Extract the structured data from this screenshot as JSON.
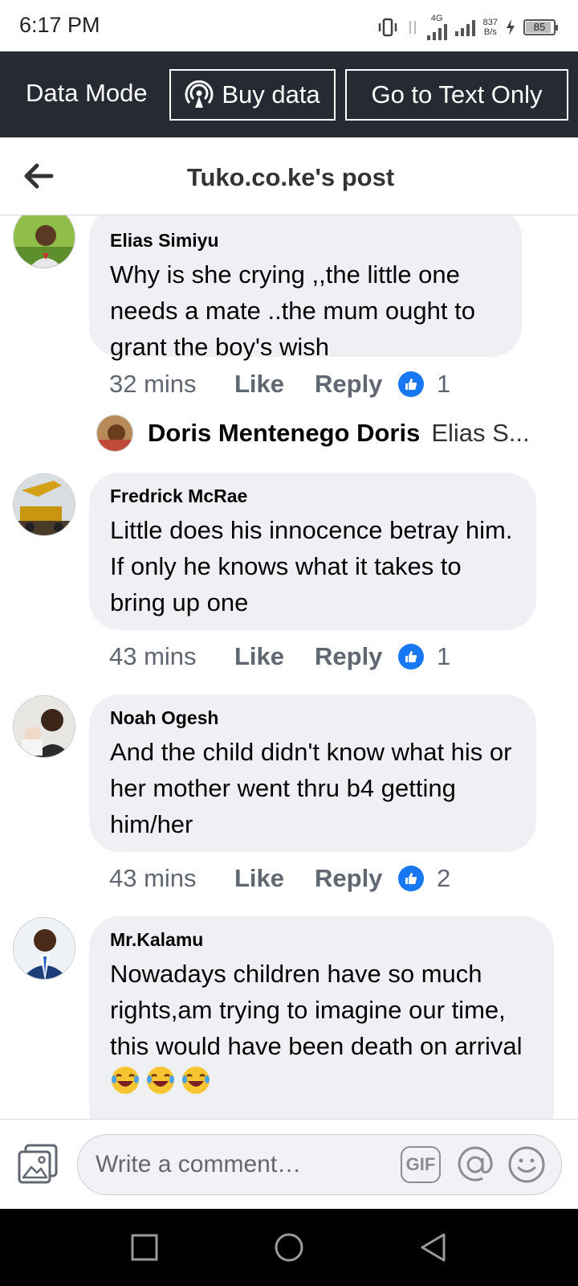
{
  "status_bar": {
    "time": "6:17 PM",
    "network_type": "4G",
    "speed_value": "837",
    "speed_unit": "B/s",
    "battery_level": "85"
  },
  "data_bar": {
    "mode_label": "Data Mode",
    "buy_label": "Buy data",
    "text_only_label": "Go to Text Only"
  },
  "header": {
    "title": "Tuko.co.ke's post"
  },
  "comments": [
    {
      "name": "Elias Simiyu",
      "text": "Why is she crying ,,the little one needs a mate ..the mum ought to grant the boy's wish",
      "time": "32 mins",
      "like": "Like",
      "reply": "Reply",
      "reactions": "1"
    },
    {
      "name": "Fredrick McRae",
      "text": "Little does his innocence betray him. If only he knows what it takes to bring up one",
      "time": "43 mins",
      "like": "Like",
      "reply": "Reply",
      "reactions": "1"
    },
    {
      "name": "Noah Ogesh",
      "text": "And the child didn't know what his or her mother went thru b4 getting him/her",
      "time": "43 mins",
      "like": "Like",
      "reply": "Reply",
      "reactions": "2"
    },
    {
      "name": "Mr.Kalamu",
      "text": "Nowadays children have so much rights,am trying to imagine our time, this would have been death on arrival"
    }
  ],
  "reply_preview": {
    "name": "Doris Mentenego Doris",
    "snippet": "Elias S..."
  },
  "composer": {
    "placeholder": "Write a comment…",
    "gif_label": "GIF"
  },
  "colors": {
    "data_bar_bg": "#252a33",
    "bubble_bg": "#eff0f3",
    "like_blue": "#1877f2",
    "meta_gray": "#606770"
  },
  "icons": [
    "back-arrow-icon",
    "broadcast-icon",
    "thumbs-up-icon",
    "photo-icon",
    "at-icon",
    "smiley-icon",
    "laughing-emoji-icon"
  ]
}
